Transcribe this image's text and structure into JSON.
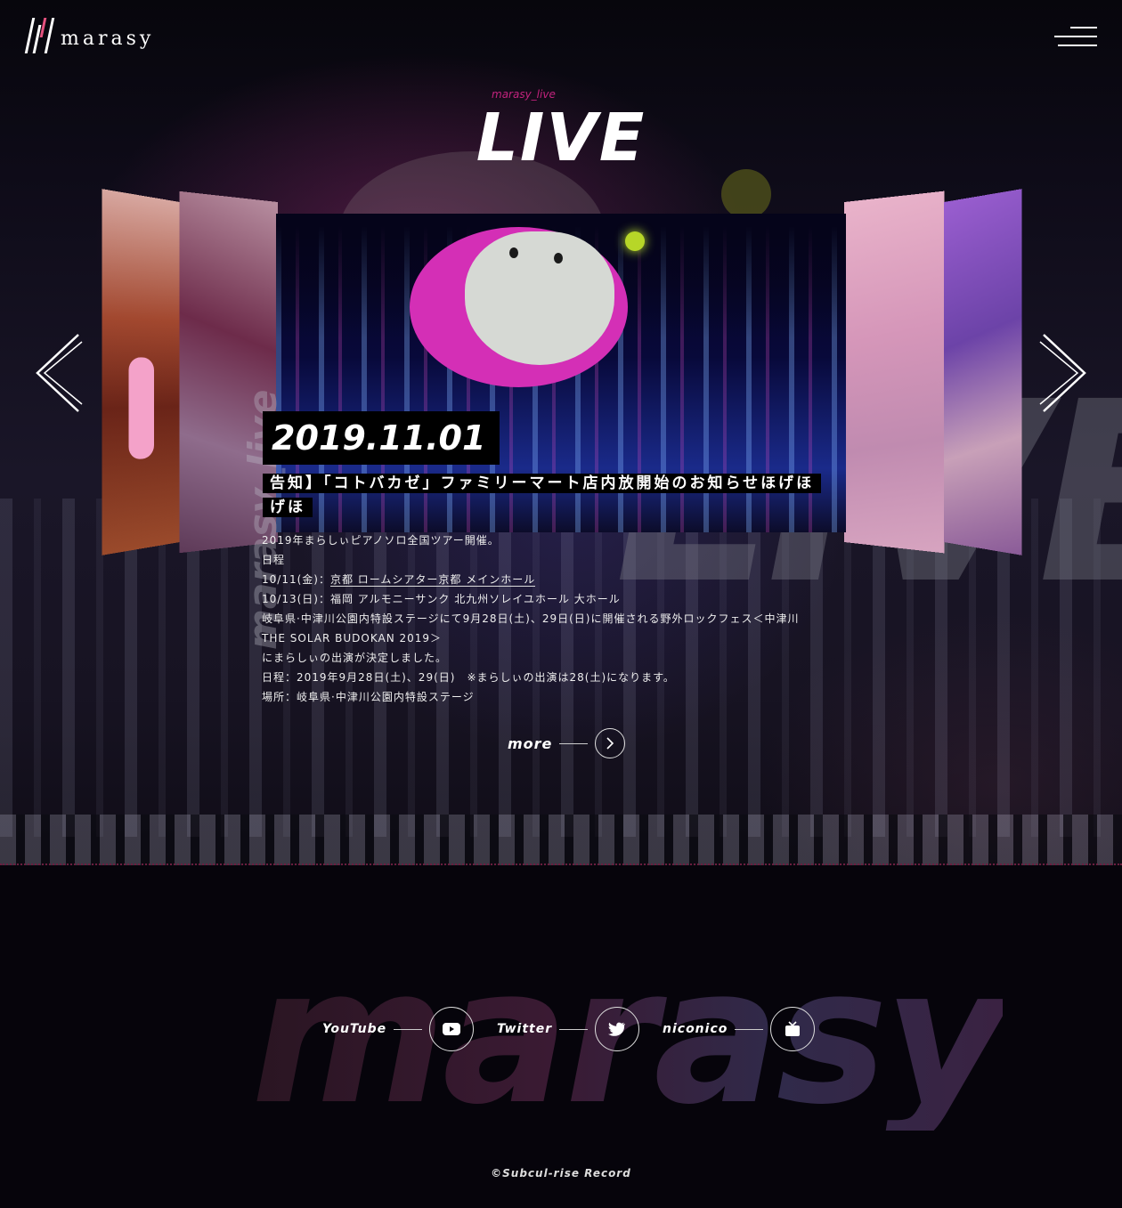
{
  "header": {
    "logo_text": "marasy"
  },
  "section": {
    "subtitle": "marasy_live",
    "title": "LIVE",
    "vertical_label": "marasy_live",
    "ghost_text": "LIVE"
  },
  "article": {
    "date": "2019.11.01",
    "headline": "告知】「コトバカゼ」ファミリーマート店内放開始のお知らせほげほげほ",
    "body": [
      "2019年まらしぃピアノソロ全国ツアー開催。",
      "日程"
    ],
    "schedule_1_prefix": "10/11(金)：",
    "schedule_1_link": "京都 ロームシアター京都 メインホール",
    "schedule_2": "10/13(日)：福岡 アルモニーサンク 北九州ソレイユホール 大ホール",
    "body_rest": [
      "岐阜県·中津川公園内特設ステージにて9月28日(土)、29日(日)に開催される野外ロックフェス＜中津川",
      "THE SOLAR BUDOKAN 2019＞",
      "にまらしぃの出演が決定しました。",
      "日程：2019年9月28日(土)、29(日)　※まらしぃの出演は28(土)になります。",
      "場所：岐阜県·中津川公園内特設ステージ"
    ]
  },
  "more_label": "more",
  "footer": {
    "ghost_text": "marasy",
    "social": [
      {
        "label": "YouTube",
        "icon": "youtube-icon"
      },
      {
        "label": "Twitter",
        "icon": "twitter-icon"
      },
      {
        "label": "niconico",
        "icon": "niconico-icon"
      }
    ],
    "copyright": "©Subcul-rise Record"
  },
  "colors": {
    "accent": "#c2237d",
    "logo_pink": "#e6527f",
    "background": "#06040b"
  }
}
